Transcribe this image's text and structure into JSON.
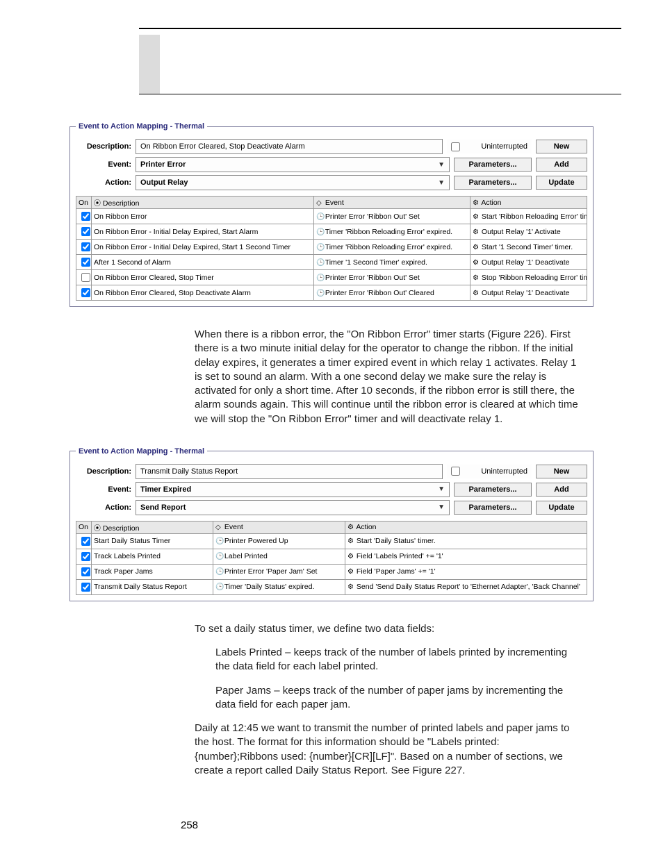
{
  "panel1": {
    "legend": "Event to Action Mapping - Thermal",
    "description_label": "Description:",
    "description_value": "On Ribbon Error Cleared, Stop Deactivate Alarm",
    "uninterrupted_label": "Uninterrupted",
    "event_label": "Event:",
    "event_value": "Printer Error",
    "action_label": "Action:",
    "action_value": "Output Relay",
    "params_btn": "Parameters...",
    "new_btn": "New",
    "add_btn": "Add",
    "update_btn": "Update",
    "headers": {
      "on": "On",
      "desc": "Description",
      "event": "Event",
      "action": "Action"
    },
    "rows": [
      {
        "on": true,
        "desc": "On Ribbon Error",
        "event": "Printer Error 'Ribbon Out' Set",
        "action": "Start 'Ribbon Reloading Error' timer."
      },
      {
        "on": true,
        "desc": "On Ribbon Error - Initial Delay Expired, Start Alarm",
        "event": "Timer 'Ribbon Reloading Error' expired.",
        "action": "Output Relay '1' Activate"
      },
      {
        "on": true,
        "desc": "On Ribbon Error - Initial Delay Expired, Start 1 Second Timer",
        "event": "Timer 'Ribbon Reloading Error' expired.",
        "action": "Start '1 Second Timer' timer."
      },
      {
        "on": true,
        "desc": "After 1 Second of Alarm",
        "event": "Timer '1 Second Timer' expired.",
        "action": "Output Relay '1' Deactivate"
      },
      {
        "on": false,
        "desc": "On Ribbon Error Cleared, Stop Timer",
        "event": "Printer Error 'Ribbon Out' Set",
        "action": "Stop 'Ribbon Reloading Error' timer."
      },
      {
        "on": true,
        "desc": "On Ribbon Error Cleared, Stop Deactivate Alarm",
        "event": "Printer Error 'Ribbon Out' Cleared",
        "action": "Output Relay '1' Deactivate"
      }
    ]
  },
  "para1": "When there is a ribbon error, the \"On Ribbon Error\" timer starts (Figure 226). First there is a two minute initial delay for the operator to change the ribbon. If the initial delay expires, it generates a timer expired event in which relay 1 activates. Relay 1 is set to sound an alarm. With a one second delay we make sure the relay is activated for only a short time. After 10 seconds, if the ribbon error is still there, the alarm sounds again. This will continue until the ribbon error is cleared at which time we will stop the \"On Ribbon Error\" timer and will deactivate relay 1.",
  "panel2": {
    "legend": "Event to Action Mapping - Thermal",
    "description_label": "Description:",
    "description_value": "Transmit Daily Status Report",
    "uninterrupted_label": "Uninterrupted",
    "event_label": "Event:",
    "event_value": "Timer Expired",
    "action_label": "Action:",
    "action_value": "Send Report",
    "params_btn": "Parameters...",
    "new_btn": "New",
    "add_btn": "Add",
    "update_btn": "Update",
    "headers": {
      "on": "On",
      "desc": "Description",
      "event": "Event",
      "action": "Action"
    },
    "rows": [
      {
        "on": true,
        "desc": "Start Daily Status Timer",
        "event": "Printer Powered Up",
        "action": "Start 'Daily Status' timer."
      },
      {
        "on": true,
        "desc": "Track Labels Printed",
        "event": "Label Printed",
        "action": "Field 'Labels Printed' += '1'"
      },
      {
        "on": true,
        "desc": "Track Paper Jams",
        "event": "Printer Error 'Paper Jam' Set",
        "action": "Field 'Paper Jams' += '1'"
      },
      {
        "on": true,
        "desc": "Transmit Daily Status Report",
        "event": "Timer 'Daily Status' expired.",
        "action": "Send 'Send Daily Status Report' to 'Ethernet Adapter', 'Back Channel'"
      }
    ]
  },
  "para2_intro": "To set a daily status timer, we define two data fields:",
  "para2_item1": "Labels Printed – keeps track of the number of labels printed by incrementing the data field for each label printed.",
  "para2_item2": "Paper Jams – keeps track of the number of paper jams by incrementing the data field for each paper jam.",
  "para3": "Daily at 12:45 we want to transmit the number of printed labels and paper jams to the host. The format for this information should be \"Labels printed: {number};Ribbons used: {number}[CR][LF]\". Based on a number of sections, we create a report called Daily Status Report. See Figure 227.",
  "page_number": "258",
  "icons": {
    "tree": "⦿",
    "diamond": "◇",
    "gear": "⚙",
    "clock": "🕒"
  }
}
